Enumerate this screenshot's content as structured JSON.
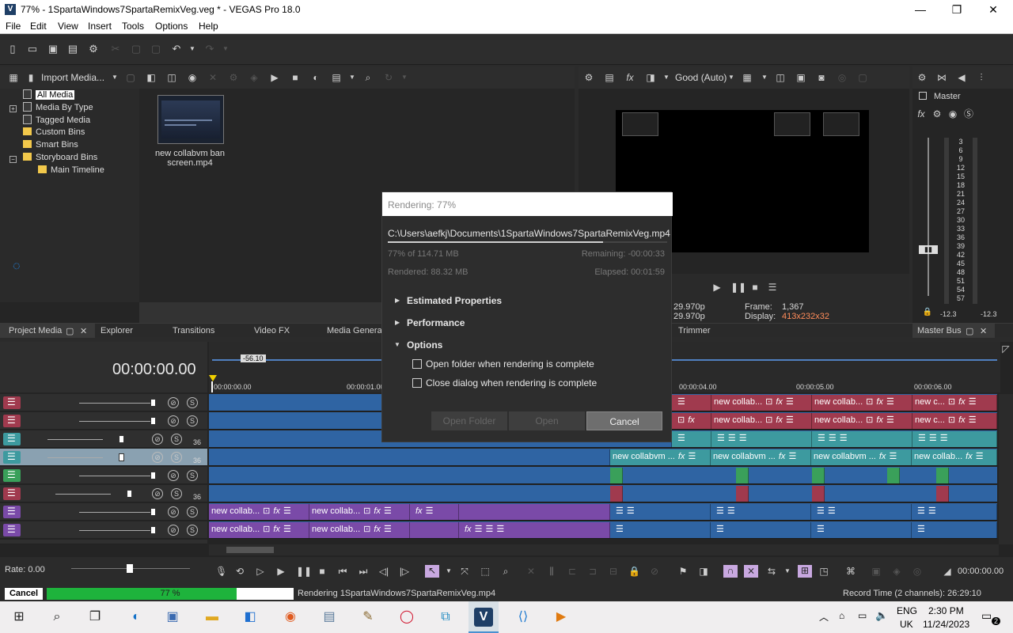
{
  "window": {
    "title": "77% - 1SpartaWindows7SpartaRemixVeg.veg * - VEGAS Pro 18.0",
    "logo_letter": "V",
    "minimize": "—",
    "maximize": "❐",
    "close": "✕"
  },
  "menu": [
    "File",
    "Edit",
    "View",
    "Insert",
    "Tools",
    "Options",
    "Help"
  ],
  "project_media": {
    "import_label": "Import Media...",
    "tree": [
      {
        "label": "All Media",
        "selected": true
      },
      {
        "label": "Media By Type",
        "expander": "+"
      },
      {
        "label": "Tagged Media"
      },
      {
        "label": "Custom Bins"
      },
      {
        "label": "Smart Bins"
      },
      {
        "label": "Storyboard Bins",
        "expander": "−"
      },
      {
        "label": "Main Timeline"
      }
    ],
    "thumb_caption": "new collabvm ban screen.mp4"
  },
  "dock_tabs": {
    "project_media": "Project Media",
    "explorer": "Explorer",
    "transitions": "Transitions",
    "video_fx": "Video FX",
    "media_generators": "Media Generat",
    "trimmer": "Trimmer",
    "master_bus": "Master Bus",
    "close_glyph": "✕"
  },
  "preview": {
    "quality": "Good (Auto)",
    "fps1": "29.970p",
    "fps2": "29.970p",
    "frame_label": "Frame:",
    "frame_value": "1,367",
    "display_label": "Display:",
    "display_value": "413x232x32"
  },
  "master": {
    "title": "Master",
    "scale": [
      "3",
      "6",
      "9",
      "12",
      "15",
      "18",
      "21",
      "24",
      "27",
      "30",
      "33",
      "36",
      "39",
      "42",
      "45",
      "48",
      "51",
      "54",
      "57"
    ],
    "left_level": "-12.3",
    "right_level": "-12.3"
  },
  "timeline": {
    "timecode": "00:00:00.00",
    "zoom_marker": "-56.10",
    "ruler": [
      "00:00:00.00",
      "00:00:01.00",
      "00:00:04.00",
      "00:00:05.00",
      "00:00:06.00"
    ],
    "clip_name_a": "new collab...",
    "clip_name_b": "new collabvm ...",
    "clip_name_c": "new collab...",
    "clip_name_d": "new c...",
    "clip_name_e": "new collab...",
    "track_numbers": [
      "36",
      "36",
      "36"
    ],
    "rate": "Rate: 0.00",
    "end_time": "00:00:00.00"
  },
  "dialog": {
    "title": "Rendering: 77%",
    "path": "C:\\Users\\aefkj\\Documents\\1SpartaWindows7SpartaRemixVeg.mp4",
    "progress_size": "77% of 114.71 MB",
    "remaining": "Remaining: -00:00:33",
    "rendered": "Rendered: 88.32 MB",
    "elapsed": "Elapsed: 00:01:59",
    "sections": [
      "Estimated Properties",
      "Performance",
      "Options"
    ],
    "option1": "Open folder when rendering is complete",
    "option2": "Close dialog when rendering is complete",
    "btn_open_folder": "Open Folder",
    "btn_open": "Open",
    "btn_cancel": "Cancel"
  },
  "status": {
    "cancel": "Cancel",
    "progress_text": "77 %",
    "progress": 0.77,
    "rendering_text": "Rendering  1SpartaWindows7SpartaRemixVeg.mp4",
    "record_time": "Record Time (2 channels): 26:29:10"
  },
  "taskbar": {
    "lang1": "ENG",
    "lang2": "UK",
    "time": "2:30 PM",
    "date": "11/24/2023",
    "notif_count": "2"
  },
  "colors": {
    "track_red": "#a03a4e",
    "track_teal": "#3d9a9f",
    "track_blue": "#2f64a3",
    "track_purple": "#7a4aa8",
    "track_green": "#3aa05a",
    "progress_green": "#1eb33c"
  }
}
